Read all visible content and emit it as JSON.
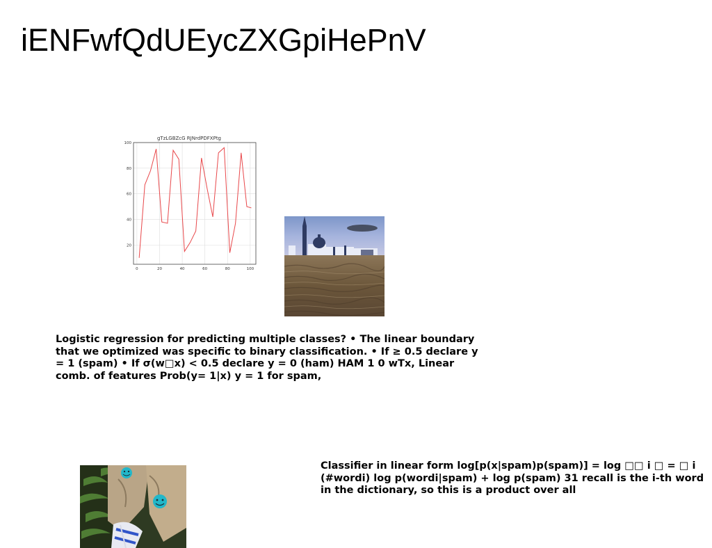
{
  "title": "iENFwfQdUEycZXGpiHePnV",
  "paragraph1": "Logistic regression for predicting multiple classes? • The linear boundary that we optimized was specific to binary classification. • If ≥ 0.5 declare y = 1 (spam) • If σ(w□x) < 0.5 declare y = 0 (ham) HAM 1 0 wTx, Linear comb. of features Prob(y= 1|x) y = 1 for spam,",
  "paragraph2": "Classifier in linear form log[p(x|spam)p(spam)] = log □□ i □ = □ i (#wordi) log p(wordi|spam) + log p(spam) 31 recall is the i-th word in the dictionary, so this is a product over all",
  "chart_data": {
    "type": "line",
    "title": "gTzLGBZcG RJNrdPDFXPtg",
    "xlabel": "",
    "ylabel": "",
    "xlim": [
      -3,
      105
    ],
    "ylim": [
      5,
      100
    ],
    "x_ticks": [
      0,
      20,
      40,
      60,
      80,
      100
    ],
    "y_ticks": [
      20,
      40,
      60,
      80,
      100
    ],
    "grid": true,
    "line_color": "#e8474a",
    "x": [
      2,
      7,
      12,
      17,
      22,
      27,
      32,
      37,
      42,
      47,
      52,
      57,
      62,
      67,
      72,
      77,
      82,
      87,
      92,
      97,
      101
    ],
    "y": [
      10,
      67,
      78,
      95,
      38,
      37,
      94,
      87,
      15,
      22,
      31,
      88,
      64,
      42,
      92,
      96,
      14,
      37,
      92,
      50,
      49
    ]
  },
  "images": {
    "venice": "venice-church-photo",
    "shoes": "sneakers-fern-photo"
  }
}
